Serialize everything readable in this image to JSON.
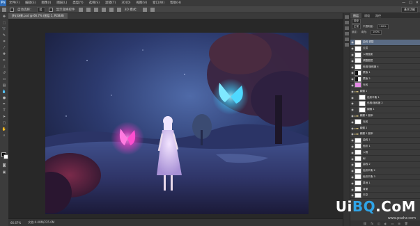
{
  "app": {
    "logo": "Ps"
  },
  "menu": [
    "文件(F)",
    "编辑(E)",
    "图像(I)",
    "图层(L)",
    "类型(Y)",
    "选择(S)",
    "滤镜(T)",
    "3D(D)",
    "视图(V)",
    "窗口(W)",
    "帮助(H)"
  ],
  "window_controls": [
    "—",
    "□",
    "✕"
  ],
  "options": {
    "auto_select": "自动选择：",
    "auto_select_value": "组",
    "transform_controls": "显示变换控件",
    "mode_3d": "3D 模式：",
    "workspace": "基本功能"
  },
  "document": {
    "tab_title": "梦幻场景.psd @ 66.7% (图层 1, RGB/8)"
  },
  "status": {
    "zoom": "66.67%",
    "doc_size": "文档:4.40M/235.0M"
  },
  "layers_panel": {
    "tabs": [
      "图层",
      "通道",
      "路径"
    ],
    "filter_label": "类型",
    "blend_mode": "正常",
    "opacity_label": "不透明度：",
    "opacity": "100%",
    "lock_label": "锁定：",
    "fill_label": "填充：",
    "fill": "100%",
    "layers": [
      {
        "name": "曲线 调整",
        "selected": true,
        "thumb": "white",
        "indent": 0
      },
      {
        "name": "云层",
        "thumb": "white",
        "indent": 0
      },
      {
        "name": "人物投影",
        "thumb": "white",
        "indent": 0
      },
      {
        "name": "调整图层",
        "thumb": "white",
        "indent": 0
      },
      {
        "name": "色相/饱和度 4",
        "thumb": "white",
        "indent": 0
      },
      {
        "name": "蒙版 1",
        "thumb": "half",
        "indent": 0
      },
      {
        "name": "蒙版 2",
        "thumb": "half",
        "indent": 0
      },
      {
        "name": "光效",
        "thumb": "pink",
        "indent": 0
      },
      {
        "name": "蝴蝶 1",
        "thumb": "folder",
        "indent": 0
      },
      {
        "name": "色彩平衡 1",
        "thumb": "white",
        "indent": 1
      },
      {
        "name": "色相/饱和度 2",
        "thumb": "white",
        "indent": 1
      },
      {
        "name": "蝴蝶 1",
        "thumb": "white",
        "indent": 1
      },
      {
        "name": "蝴蝶 2 副本",
        "thumb": "folder",
        "indent": 0
      },
      {
        "name": "光效",
        "thumb": "white",
        "indent": 0
      },
      {
        "name": "蝴蝶 2",
        "thumb": "folder",
        "indent": 0
      },
      {
        "name": "蝴蝶 2 副本",
        "thumb": "folder",
        "indent": 0
      },
      {
        "name": "曲线 1",
        "thumb": "white",
        "indent": 0
      },
      {
        "name": "色阶 1",
        "thumb": "white",
        "indent": 0
      },
      {
        "name": "人物",
        "thumb": "white",
        "indent": 0
      },
      {
        "name": "树",
        "thumb": "white",
        "indent": 0
      },
      {
        "name": "曲线 2",
        "thumb": "white",
        "indent": 0
      },
      {
        "name": "色彩平衡 2",
        "thumb": "white",
        "indent": 0
      },
      {
        "name": "色彩平衡 3",
        "thumb": "white",
        "indent": 0
      },
      {
        "name": "草地 1",
        "thumb": "white",
        "indent": 0
      },
      {
        "name": "背景",
        "thumb": "white",
        "indent": 0
      },
      {
        "name": "天空",
        "thumb": "white",
        "indent": 0
      }
    ]
  },
  "watermark": {
    "part1": "Ui",
    "part2": "BQ",
    "part3": ".CoM",
    "url": "www.psahz.com"
  },
  "colors": {
    "accent": "#5a6b84",
    "butterfly_cyan": "#3fd2ff",
    "butterfly_pink": "#ff3cc8"
  }
}
